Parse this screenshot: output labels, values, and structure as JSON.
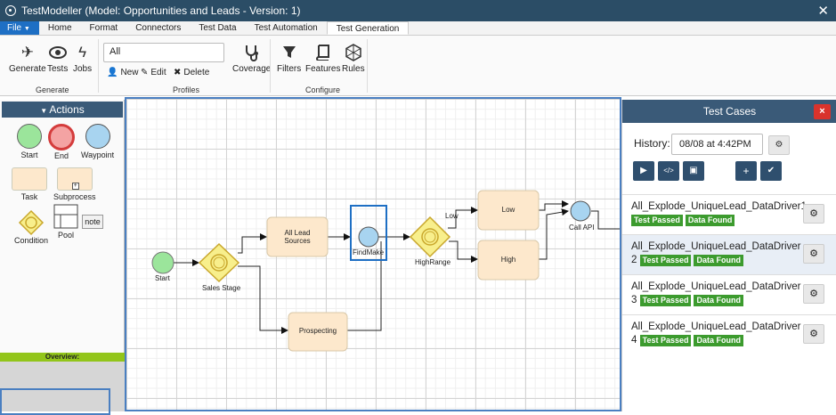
{
  "window": {
    "title": "TestModeller (Model: Opportunities and Leads - Version: 1)"
  },
  "menu": {
    "file": "File",
    "tabs": [
      "Home",
      "Format",
      "Connectors",
      "Test Data",
      "Test Automation",
      "Test Generation"
    ]
  },
  "ribbon": {
    "generate": {
      "generate": "Generate",
      "tests": "Tests",
      "jobs": "Jobs",
      "group": "Generate"
    },
    "profiles": {
      "value": "All",
      "new": "New",
      "edit": "Edit",
      "delete": "Delete",
      "coverage": "Coverage",
      "group": "Profiles"
    },
    "configure": {
      "filters": "Filters",
      "features": "Features",
      "rules": "Rules",
      "group": "Configure"
    }
  },
  "palette": {
    "header": "Actions",
    "start": "Start",
    "end": "End",
    "waypoint": "Waypoint",
    "task": "Task",
    "subprocess": "Subprocess",
    "condition": "Condition",
    "pool": "Pool",
    "note": "note",
    "overview": "Overview:"
  },
  "diagram": {
    "start": "Start",
    "sales_stage": "Sales Stage",
    "all_lead_1": "All Lead",
    "all_lead_2": "Sources",
    "prospecting": "Prospecting",
    "findmake": "FindMake",
    "highrange": "HighRange",
    "low": "Low",
    "high": "High",
    "low_edge": "Low",
    "call_api": "Call API"
  },
  "test_cases": {
    "title": "Test Cases",
    "history_label": "History:",
    "history_value": "08/08 at 4:42PM",
    "items": [
      {
        "name": "All_Explode_UniqueLead_DataDriver1",
        "badges": [
          "Test Passed",
          "Data Found"
        ]
      },
      {
        "name": "All_Explode_UniqueLead_DataDriver",
        "num": "2",
        "badges": [
          "Test Passed",
          "Data Found"
        ]
      },
      {
        "name": "All_Explode_UniqueLead_DataDriver",
        "num": "3",
        "badges": [
          "Test Passed",
          "Data Found"
        ]
      },
      {
        "name": "All_Explode_UniqueLead_DataDriver",
        "num": "4",
        "badges": [
          "Test Passed",
          "Data Found"
        ]
      }
    ]
  }
}
